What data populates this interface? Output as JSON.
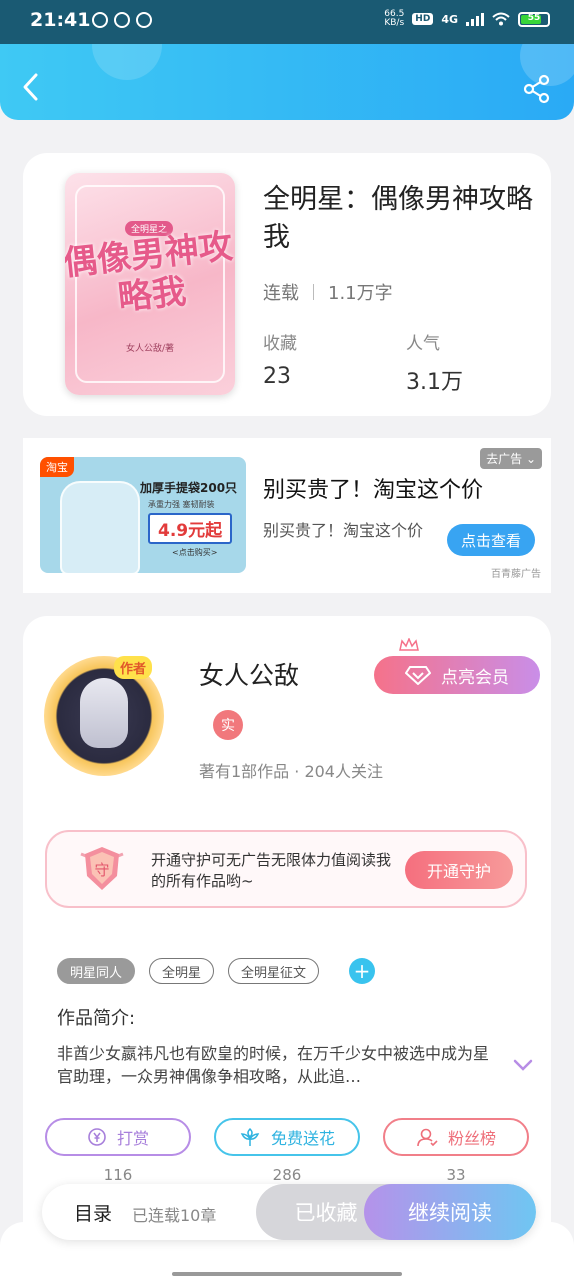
{
  "status_bar": {
    "time": "21:41",
    "net_speed_value": "66.5",
    "net_speed_unit": "KB/s",
    "hd": "HD",
    "network": "4G",
    "battery": "55"
  },
  "book": {
    "title": "全明星：偶像男神攻略我",
    "status": "连载",
    "word_count": "1.1万字",
    "collect_label": "收藏",
    "collect_value": "23",
    "popularity_label": "人气",
    "popularity_value": "3.1万",
    "cover_title": "偶像男神攻略我",
    "cover_tag": "全明星之",
    "cover_author": "女人公敌/著"
  },
  "ad": {
    "platform_badge": "淘宝",
    "img_headline": "加厚手提袋200只",
    "img_sub": "承重力强 塞韧耐装",
    "img_price": "4.9元起",
    "img_cta": "<点击购买>",
    "title": "别买贵了！淘宝这个价",
    "desc": "别买贵了！淘宝这个价",
    "button": "点击查看",
    "close": "去广告",
    "source": "百青藤广告"
  },
  "author": {
    "name": "女人公敌",
    "badge": "实",
    "avatar_tag": "作者",
    "meta": "著有1部作品 · 204人关注",
    "vip_button": "点亮会员"
  },
  "guard": {
    "text": "开通守护可无广告无限体力值阅读我的所有作品哟~",
    "button": "开通守护",
    "shield_char": "守"
  },
  "tags": [
    "明星同人",
    "全明星",
    "全明星征文"
  ],
  "intro": {
    "label": "作品简介:",
    "text": "非酋少女嬴祎凡也有欧皇的时候，在万千少女中被选中成为星官助理，一众男神偶像争相攻略，从此追…"
  },
  "actions": {
    "tip_label": "打赏",
    "tip_count": "116",
    "flower_label": "免费送花",
    "flower_count": "286",
    "fans_label": "粉丝榜",
    "fans_count": "33"
  },
  "bottom": {
    "toc": "目录",
    "toc_sub": "已连载10章",
    "collected": "已收藏",
    "continue": "继续阅读"
  },
  "colors": {
    "header_start": "#3fc9f4",
    "header_end": "#2aaaf5",
    "accent_blue": "#38a4f2",
    "vip_pink": "#f5728a"
  }
}
